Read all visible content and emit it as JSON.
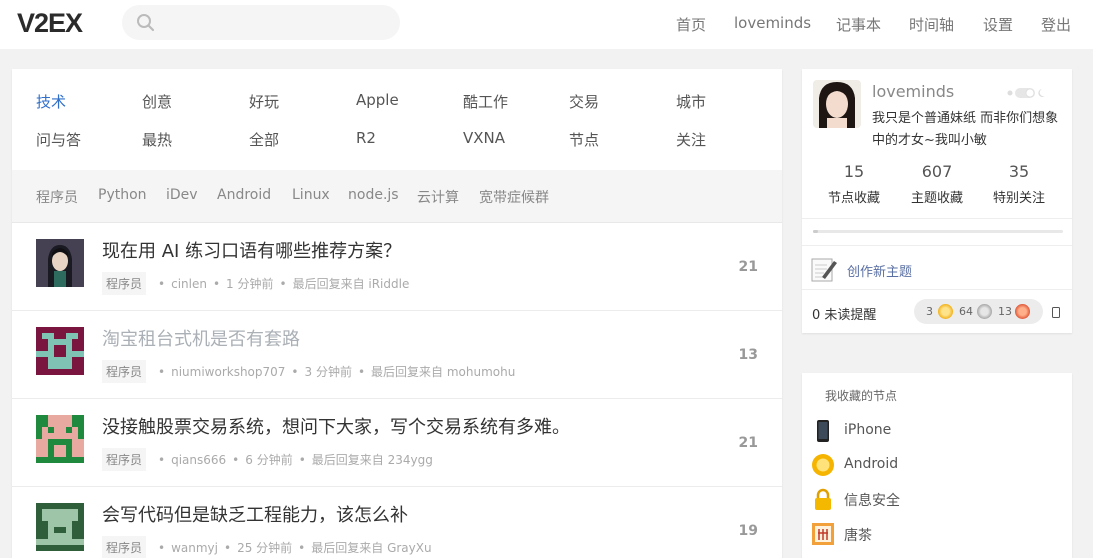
{
  "header": {
    "logo": "V2EX",
    "nav": [
      "首页",
      "loveminds",
      "记事本",
      "时间轴",
      "设置",
      "登出"
    ]
  },
  "tabs": {
    "row1": [
      "技术",
      "创意",
      "好玩",
      "Apple",
      "酷工作",
      "交易",
      "城市"
    ],
    "row2": [
      "问与答",
      "最热",
      "全部",
      "R2",
      "VXNA",
      "节点",
      "关注"
    ],
    "active": "技术"
  },
  "subtabs": [
    "程序员",
    "Python",
    "iDev",
    "Android",
    "Linux",
    "node.js",
    "云计算",
    "宽带症候群"
  ],
  "topics": [
    {
      "title": "现在用 AI 练习口语有哪些推荐方案？",
      "node": "程序员",
      "author": "cinlen",
      "time": "1 分钟前",
      "last_reply": "最后回复来自 iRiddle",
      "replies": "21",
      "visited": false
    },
    {
      "title": "淘宝租台式机是否有套路",
      "node": "程序员",
      "author": "niumiworkshop707",
      "time": "3 分钟前",
      "last_reply": "最后回复来自 mohumohu",
      "replies": "13",
      "visited": true
    },
    {
      "title": "没接触股票交易系统，想问下大家，写个交易系统有多难。",
      "node": "程序员",
      "author": "qians666",
      "time": "6 分钟前",
      "last_reply": "最后回复来自 234ygg",
      "replies": "21",
      "visited": false
    },
    {
      "title": "会写代码但是缺乏工程能力，该怎么补",
      "node": "程序员",
      "author": "wanmyj",
      "time": "25 分钟前",
      "last_reply": "最后回复来自 GrayXu",
      "replies": "19",
      "visited": false
    }
  ],
  "user": {
    "name": "loveminds",
    "bio": "我只是个普通妹纸 而非你们想象中的才女~我叫小敏",
    "stats": [
      {
        "value": "15",
        "label": "节点收藏"
      },
      {
        "value": "607",
        "label": "主题收藏"
      },
      {
        "value": "35",
        "label": "特别关注"
      }
    ],
    "progress": 0.02,
    "create_label": "创作新主题",
    "unread": "0 未读提醒",
    "balance": {
      "gold": "3",
      "silver": "64",
      "bronze": "13"
    }
  },
  "fav_nodes": {
    "heading": "我收藏的节点",
    "items": [
      {
        "label": "iPhone",
        "icon": "iphone-icon"
      },
      {
        "label": "Android",
        "icon": "android-icon"
      },
      {
        "label": "信息安全",
        "icon": "lock-icon"
      },
      {
        "label": "唐茶",
        "icon": "tangcha-icon"
      }
    ]
  },
  "colors": {
    "accent": "#2f6fca",
    "background": "#f2f2f2",
    "visited_title": "#aab0b5",
    "link_blue": "#5a6fa3"
  }
}
